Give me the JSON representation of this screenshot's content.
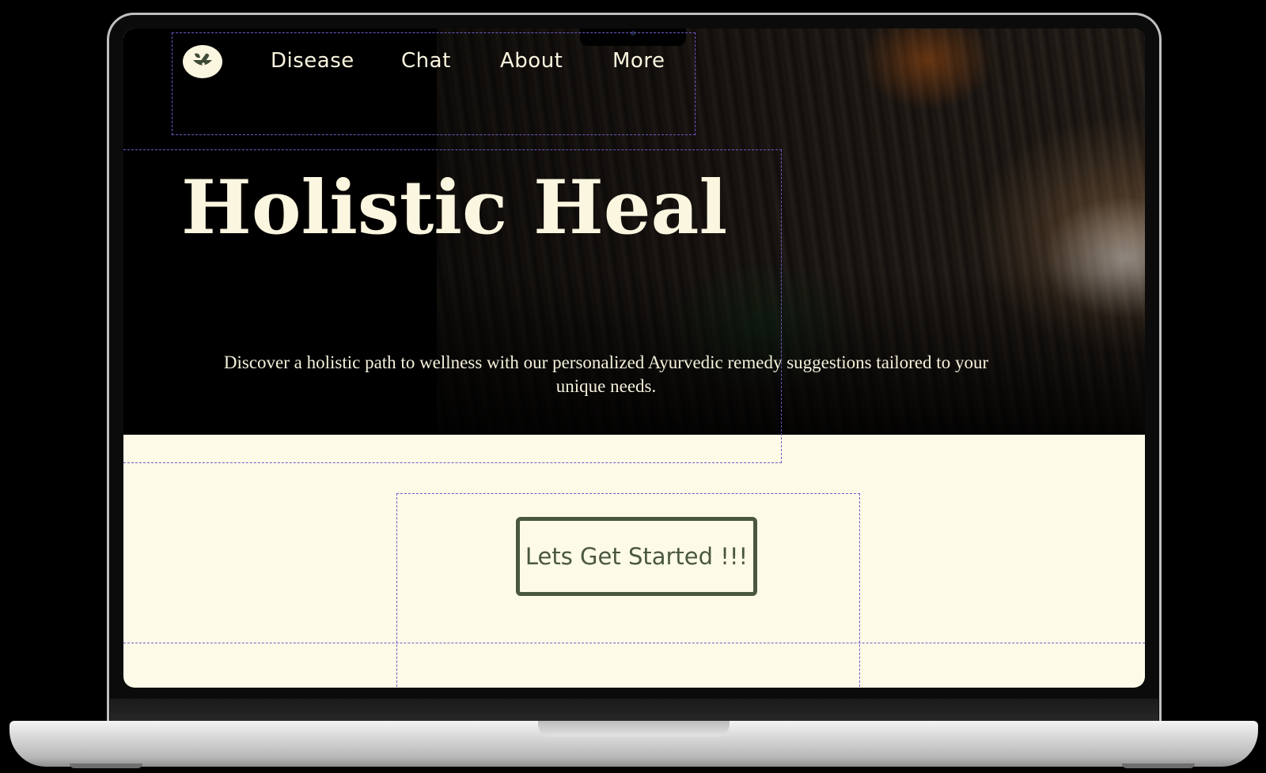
{
  "nav": {
    "links": [
      "Disease",
      "Chat",
      "About",
      "More"
    ]
  },
  "hero": {
    "title": "Holistic Heal",
    "subtitle": "Discover a holistic path to wellness with our personalized Ayurvedic remedy suggestions tailored to your unique needs."
  },
  "cta": {
    "label": "Lets Get Started !!!"
  },
  "colors": {
    "cream": "#fdfbe8",
    "hero_background": "#000000",
    "accent_green": "#4a5740",
    "guide_purple": "#6f5ac9"
  },
  "icons": {
    "logo": "mortar-pestle-leaf-icon"
  }
}
